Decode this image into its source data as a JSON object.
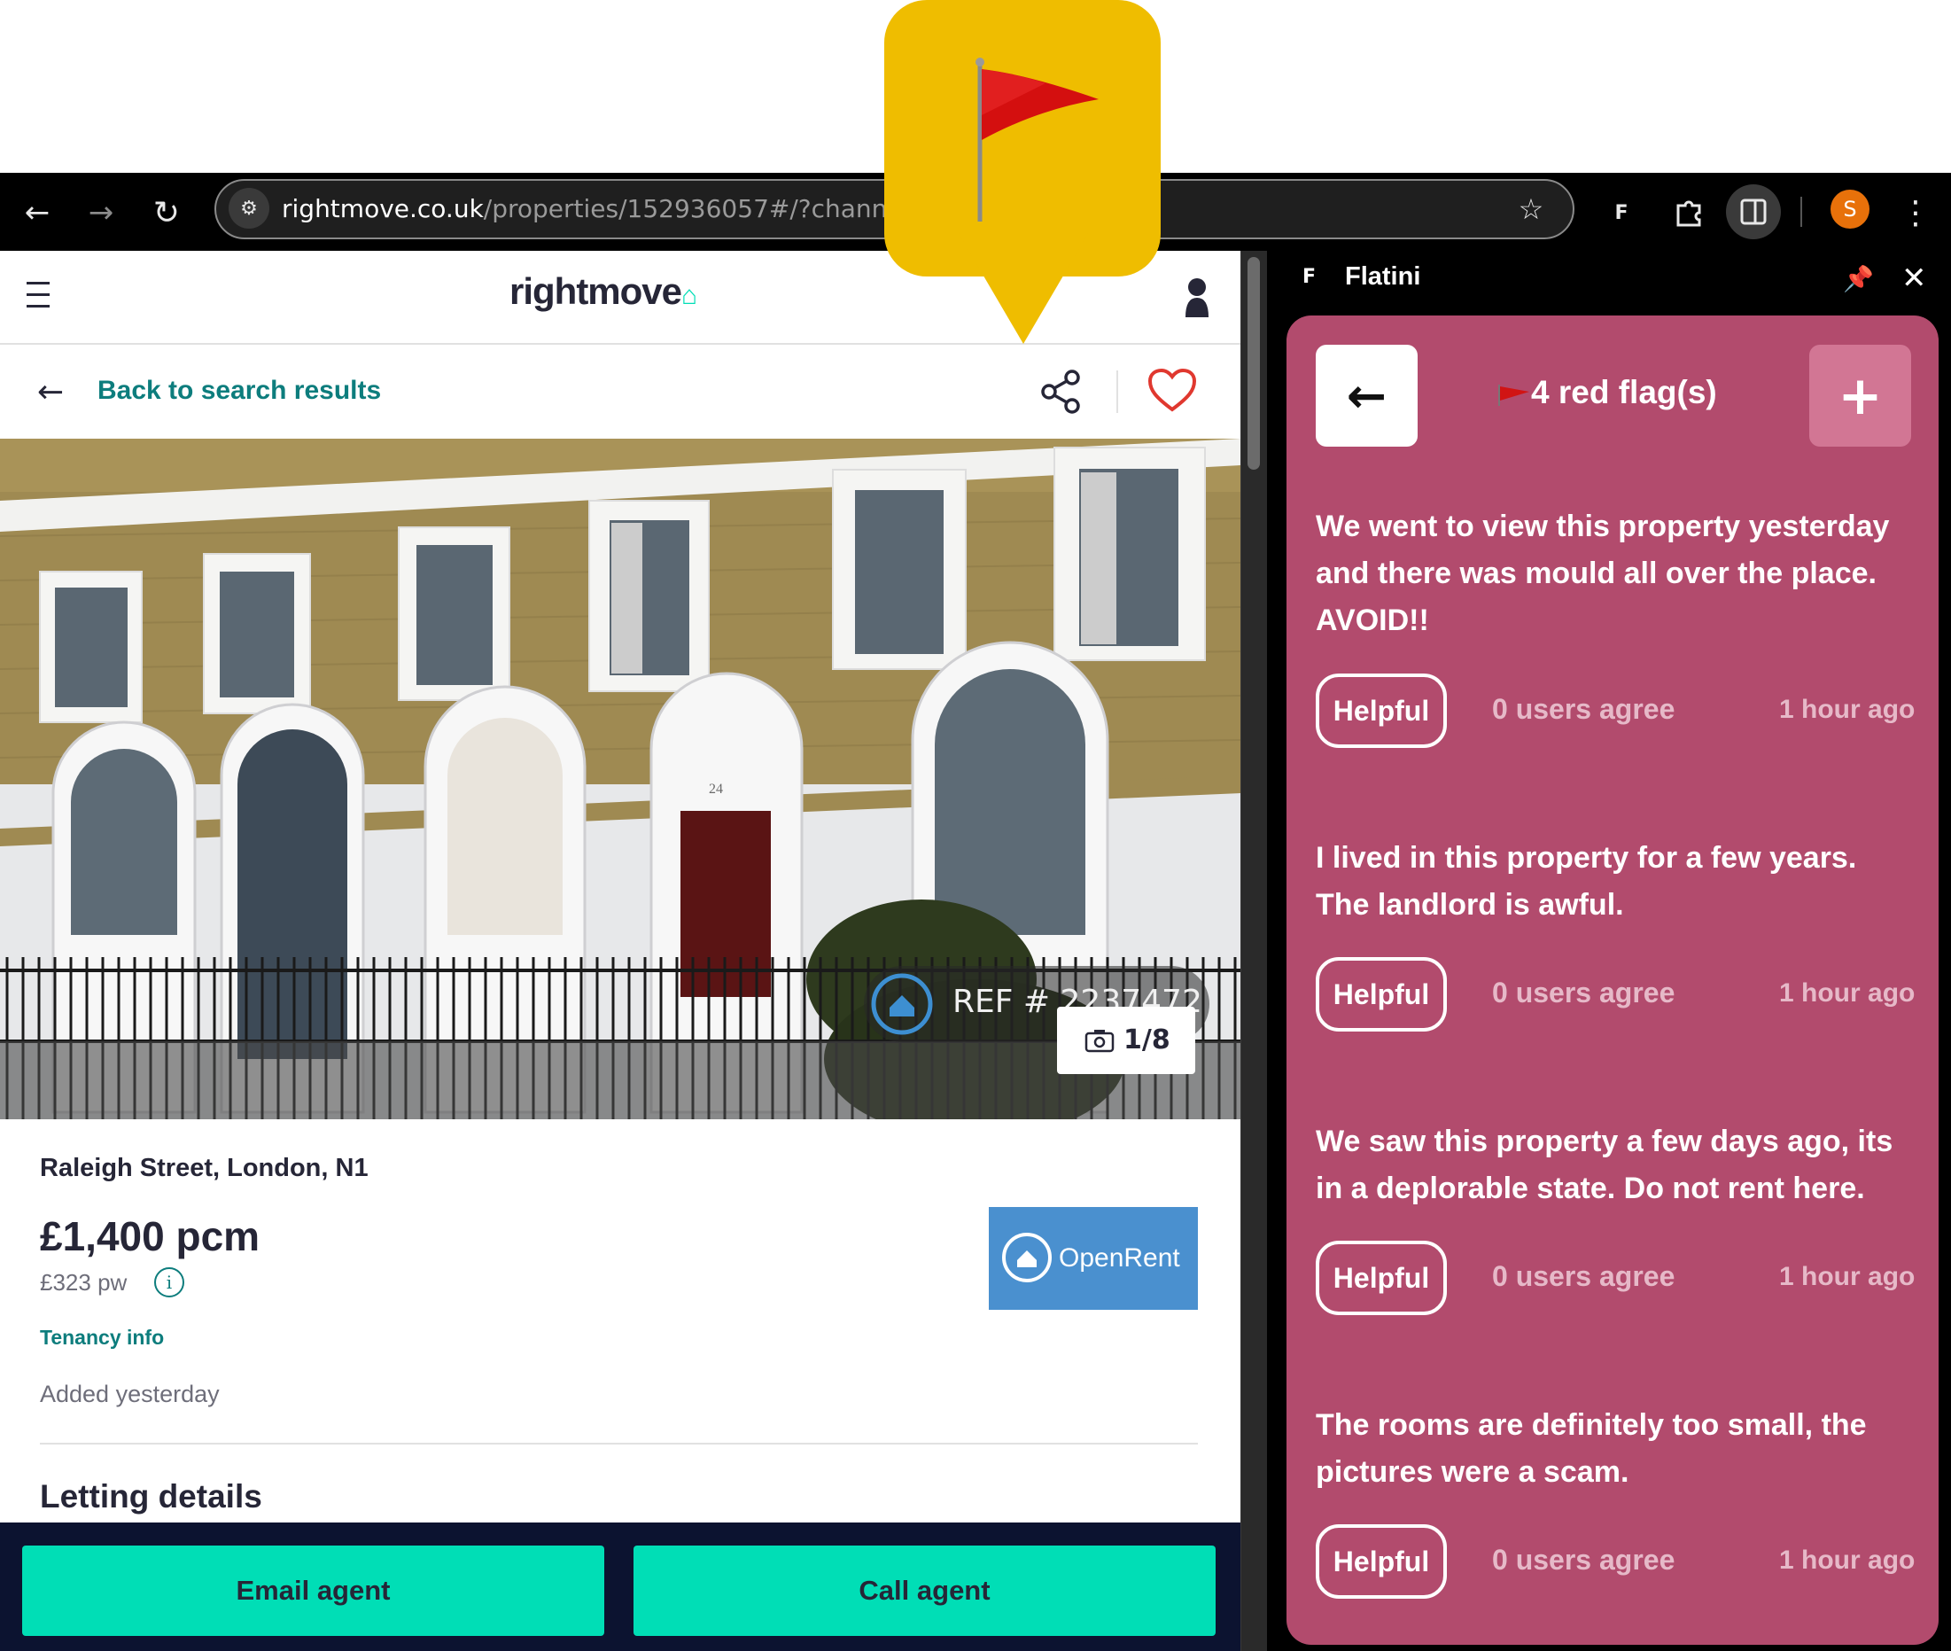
{
  "browser": {
    "url_host": "rightmove.co.uk",
    "url_path": "/properties/152936057#/?channel=",
    "avatar_letter": "S",
    "extension_icon_text": "F"
  },
  "site": {
    "logo": "rightmove",
    "back_link": "Back to search results",
    "photo_ref": "REF # 2237472",
    "photo_counter": "1/8",
    "address": "Raleigh Street, London, N1",
    "price_pcm": "£1,400 pcm",
    "price_pw": "£323 pw",
    "tenancy_info": "Tenancy info",
    "added": "Added yesterday",
    "agent_logo": "OpenRent",
    "section_title": "Letting details",
    "email_agent": "Email agent",
    "call_agent": "Call agent",
    "door_number": "24"
  },
  "panel": {
    "title": "Flatini",
    "title_icon": "F",
    "flag_count": "4 red flag(s)",
    "colors": {
      "card": "#b24b6d",
      "add_button": "#d27694",
      "callout": "#efbd00"
    },
    "flags": [
      {
        "text": "We went to view this property yesterday and there was mould all over the place. AVOID!!",
        "helpful": "Helpful",
        "agree": "0 users agree",
        "ago": "1 hour ago"
      },
      {
        "text": "I lived in this property for a few years. The landlord is awful.",
        "helpful": "Helpful",
        "agree": "0 users agree",
        "ago": "1 hour ago"
      },
      {
        "text": "We saw this property a few days ago, its in a deplorable state. Do not rent here.",
        "helpful": "Helpful",
        "agree": "0 users agree",
        "ago": "1 hour ago"
      },
      {
        "text": "The rooms are definitely too small, the pictures were a scam.",
        "helpful": "Helpful",
        "agree": "0 users agree",
        "ago": "1 hour ago"
      }
    ]
  },
  "icons": {
    "back": "arrow-left-icon",
    "forward": "arrow-right-icon",
    "reload": "reload-icon",
    "star": "star-icon",
    "extensions": "puzzle-icon",
    "side_panel": "side-panel-icon",
    "menu": "kebab-menu-icon",
    "share": "share-icon",
    "heart": "heart-icon",
    "camera": "camera-icon",
    "info": "info-icon",
    "pin": "pin-icon",
    "close": "close-icon",
    "flag": "red-flag-icon"
  }
}
